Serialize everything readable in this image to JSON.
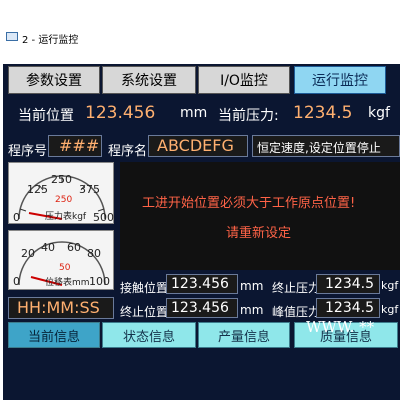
{
  "window": {
    "title": "2 - 运行监控"
  },
  "tabs": [
    {
      "label": "参数设置"
    },
    {
      "label": "系统设置"
    },
    {
      "label": "I/O监控"
    },
    {
      "label": "运行监控"
    }
  ],
  "status": {
    "position_label": "当前位置",
    "position_value": "123.456",
    "position_unit": "mm",
    "pressure_label": "当前压力:",
    "pressure_value": "1234.5",
    "pressure_unit": "kgf"
  },
  "program": {
    "number_label": "程序号",
    "number_value": "###",
    "name_label": "程序名",
    "name_value": "ABCDEFG",
    "mode_text": "恒定速度,设定位置停止"
  },
  "gauge_top": {
    "ticks": [
      "125",
      "250",
      "375",
      "0",
      "500"
    ],
    "mid": "250",
    "caption": "压力表kgf"
  },
  "gauge_bottom": {
    "ticks": [
      "20",
      "40",
      "60",
      "80",
      "0",
      "100"
    ],
    "mid": "50",
    "caption": "位移表mm"
  },
  "message": {
    "line1": "工进开始位置必须大于工作原点位置!",
    "line2": "请重新设定"
  },
  "clock": "HH:MM:SS",
  "readouts": {
    "contact_label": "接触位置",
    "contact_value": "123.456",
    "contact_unit": "mm",
    "end_pos_label": "终止位置",
    "end_pos_value": "123.456",
    "end_pos_unit": "mm",
    "end_press_label": "终止压力",
    "end_press_value": "1234.5",
    "end_press_unit": "kgf",
    "peak_label": "峰值压力",
    "peak_value": "1234.5",
    "peak_unit": "kgf"
  },
  "bottom_tabs": [
    {
      "label": "当前信息"
    },
    {
      "label": "状态信息"
    },
    {
      "label": "产量信息"
    },
    {
      "label": "质量信息"
    }
  ],
  "watermark": "WWW. **"
}
